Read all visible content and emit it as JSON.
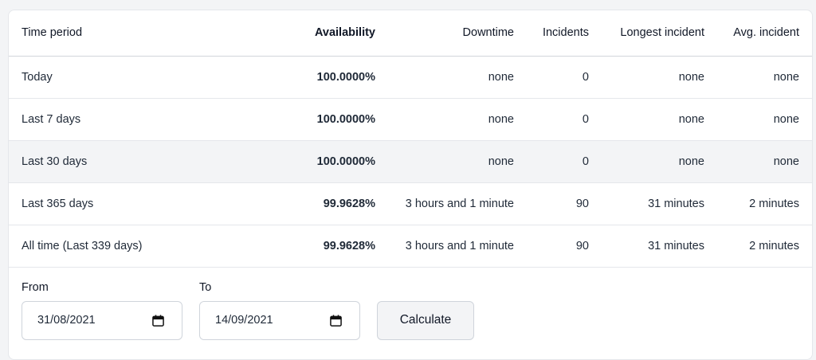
{
  "table": {
    "headers": {
      "period": "Time period",
      "availability": "Availability",
      "downtime": "Downtime",
      "incidents": "Incidents",
      "longest": "Longest incident",
      "avg": "Avg. incident"
    },
    "rows": [
      {
        "period": "Today",
        "availability": "100.0000%",
        "downtime": "none",
        "incidents": "0",
        "longest": "none",
        "avg": "none"
      },
      {
        "period": "Last 7 days",
        "availability": "100.0000%",
        "downtime": "none",
        "incidents": "0",
        "longest": "none",
        "avg": "none"
      },
      {
        "period": "Last 30 days",
        "availability": "100.0000%",
        "downtime": "none",
        "incidents": "0",
        "longest": "none",
        "avg": "none"
      },
      {
        "period": "Last 365 days",
        "availability": "99.9628%",
        "downtime": "3 hours and 1 minute",
        "incidents": "90",
        "longest": "31 minutes",
        "avg": "2 minutes"
      },
      {
        "period": "All time (Last 339 days)",
        "availability": "99.9628%",
        "downtime": "3 hours and 1 minute",
        "incidents": "90",
        "longest": "31 minutes",
        "avg": "2 minutes"
      }
    ]
  },
  "form": {
    "from_label": "From",
    "from_value": "31/08/2021",
    "to_label": "To",
    "to_value": "14/09/2021",
    "calculate_label": "Calculate",
    "calendar_icon": "calendar-icon"
  },
  "colors": {
    "highlight_row": "#f3f4f6",
    "border": "#e5e7eb"
  }
}
